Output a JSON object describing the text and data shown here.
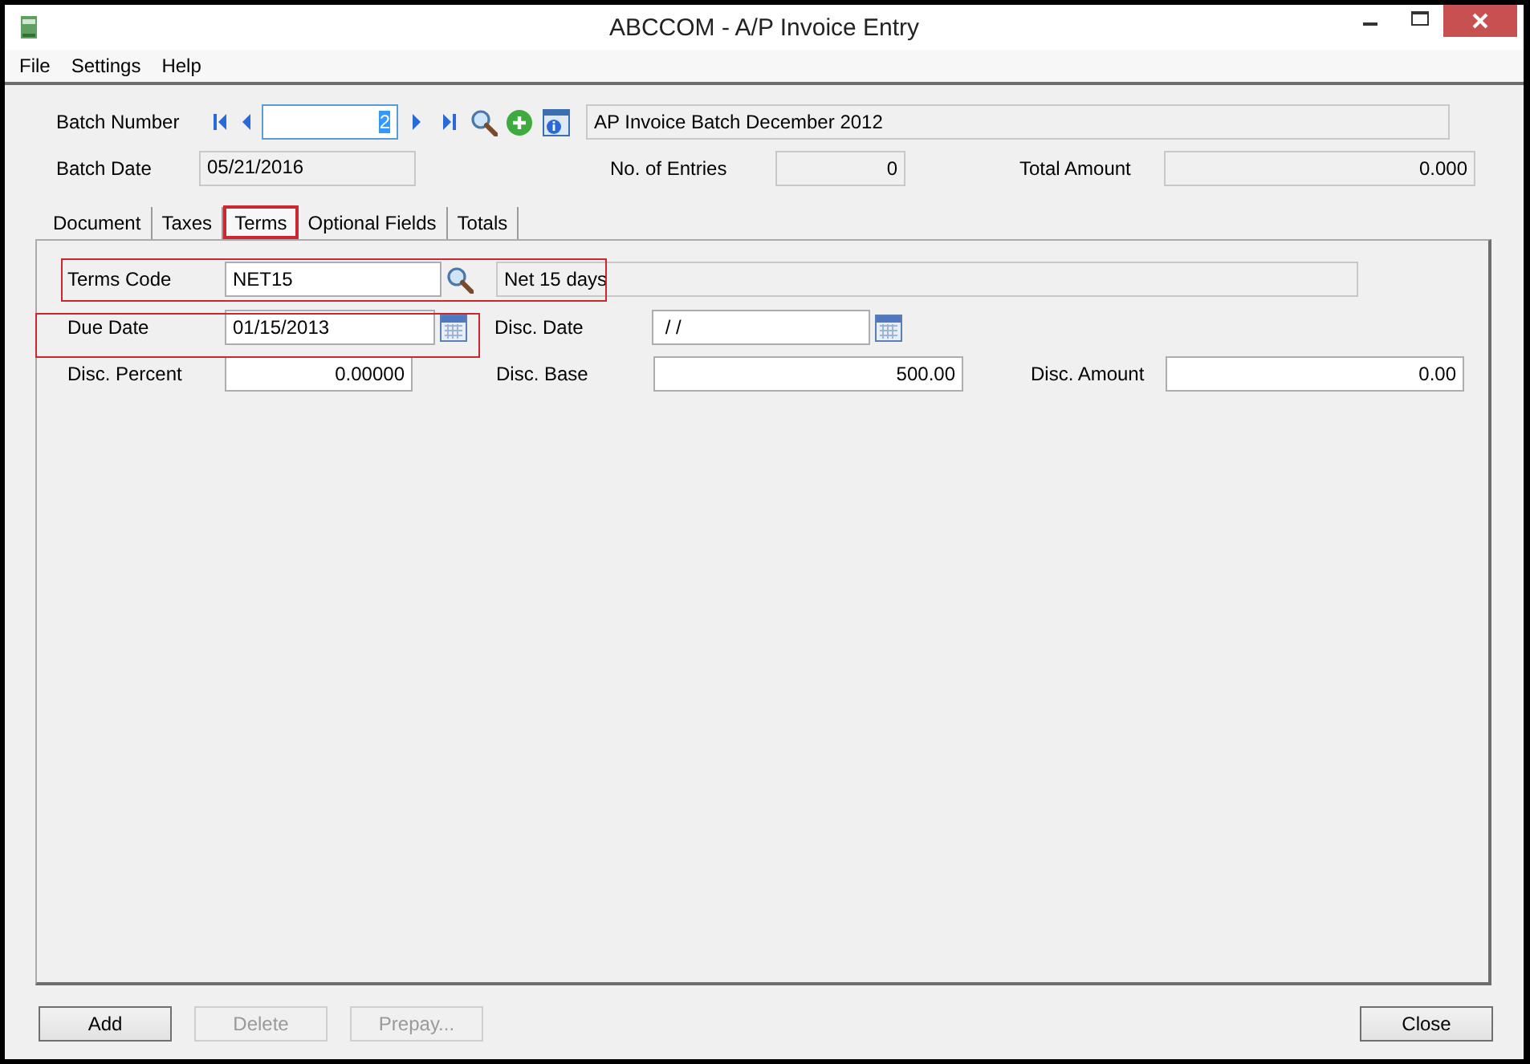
{
  "window": {
    "title": "ABCCOM - A/P Invoice Entry"
  },
  "menu": [
    "File",
    "Settings",
    "Help"
  ],
  "header": {
    "batch_number": {
      "label": "Batch Number",
      "value": "2",
      "text_selected": true
    },
    "batch_description": {
      "value": "AP Invoice Batch December 2012",
      "readonly": true
    },
    "batch_date": {
      "label": "Batch Date",
      "value": "05/21/2016",
      "readonly": true
    },
    "entries": {
      "label": "No. of Entries",
      "value": "0",
      "readonly": true
    },
    "total_amount": {
      "label": "Total Amount",
      "value": "0.000",
      "readonly": true
    }
  },
  "tabs": [
    {
      "label": "Document",
      "selected": false,
      "highlighted": false
    },
    {
      "label": "Taxes",
      "selected": false,
      "highlighted": false
    },
    {
      "label": "Terms",
      "selected": true,
      "highlighted": true
    },
    {
      "label": "Optional Fields",
      "selected": false,
      "highlighted": false
    },
    {
      "label": "Totals",
      "selected": false,
      "highlighted": false
    }
  ],
  "terms": {
    "terms_code": {
      "label": "Terms Code",
      "value": "NET15",
      "readonly": false,
      "highlighted": true
    },
    "terms_description": {
      "value": "Net 15 days",
      "readonly": true
    },
    "due_date": {
      "label": "Due Date",
      "value": "01/15/2013",
      "readonly": false,
      "highlighted": true
    },
    "disc_date": {
      "label": "Disc. Date",
      "value": " / /",
      "readonly": false
    },
    "disc_percent": {
      "label": "Disc. Percent",
      "value": "0.00000",
      "readonly": false
    },
    "disc_base": {
      "label": "Disc. Base",
      "value": "500.00",
      "readonly": false
    },
    "disc_amount": {
      "label": "Disc. Amount",
      "value": "0.00",
      "readonly": false
    }
  },
  "buttons": [
    {
      "label": "Add",
      "disabled": false
    },
    {
      "label": "Delete",
      "disabled": true
    },
    {
      "label": "Prepay...",
      "disabled": true
    },
    {
      "label": "Close",
      "disabled": false
    }
  ]
}
